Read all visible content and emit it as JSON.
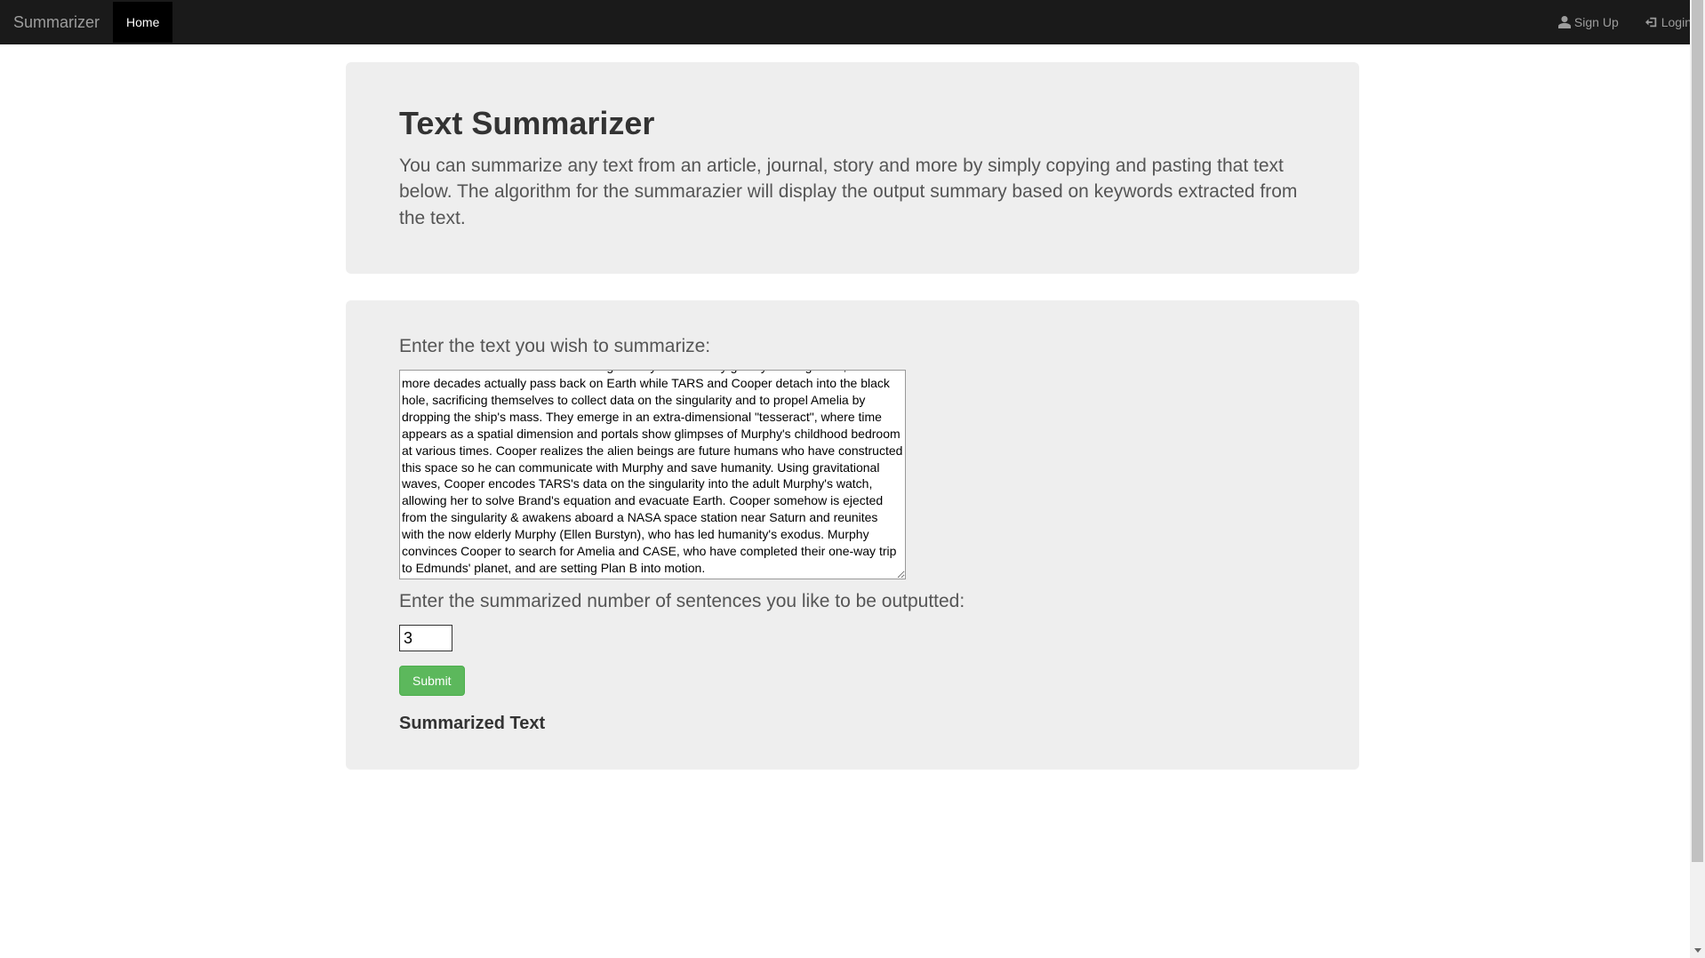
{
  "nav": {
    "brand": "Summarizer",
    "home": "Home",
    "signup": "Sign Up",
    "login": "Login"
  },
  "hero": {
    "title": "Text Summarizer",
    "description": "You can summarize any text from an article, journal, story and more by simply copying and pasting that text below. The algorithm for the summarazier will display the output summary based on keywords extracted from the text."
  },
  "form": {
    "text_label": "Enter the text you wish to summarize:",
    "text_value": "course toward Edmunds. Due to being directly in the heavy gravity of Gargantua, several more decades actually pass back on Earth while TARS and Cooper detach into the black hole, sacrificing themselves to collect data on the singularity and to propel Amelia by dropping the ship's mass. They emerge in an extra-dimensional \"tesseract\", where time appears as a spatial dimension and portals show glimpses of Murphy's childhood bedroom at various times. Cooper realizes the alien beings are future humans who have constructed this space so he can communicate with Murphy and save humanity. Using gravitational waves, Cooper encodes TARS's data on the singularity into the adult Murphy's watch, allowing her to solve Brand's equation and evacuate Earth. Cooper somehow is ejected from the singularity & awakens aboard a NASA space station near Saturn and reunites with the now elderly Murphy (Ellen Burstyn), who has led humanity's exodus. Murphy convinces Cooper to search for Amelia and CASE, who have completed their one-way trip to Edmunds' planet, and are setting Plan B into motion.",
    "sentences_label": "Enter the summarized number of sentences you like to be outputted:",
    "sentences_value": "3",
    "submit_label": "Submit",
    "output_heading": "Summarized Text"
  }
}
